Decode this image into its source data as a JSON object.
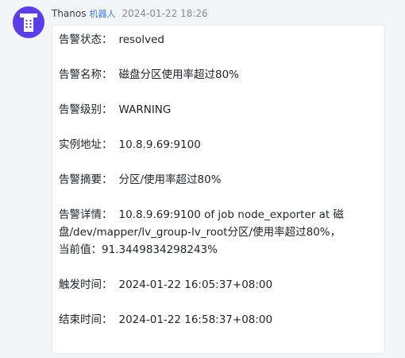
{
  "message": {
    "sender": "Thanos",
    "bot_tag": "机器人",
    "timestamp": "2024-01-22 18:26",
    "avatar_color": "#5b3ee8"
  },
  "alert": {
    "fields": [
      {
        "label": "告警状态：",
        "value": "resolved"
      },
      {
        "label": "告警名称：",
        "value": "磁盘分区使用率超过80%"
      },
      {
        "label": "告警级别：",
        "value": "WARNING"
      },
      {
        "label": "实例地址：",
        "value": "10.8.9.69:9100"
      },
      {
        "label": "告警摘要：",
        "value": "分区/使用率超过80%"
      },
      {
        "label": "告警详情：",
        "value": "10.8.9.69:9100 of job node_exporter at 磁盘/dev/mapper/lv_group-lv_root分区/使用率超过80%，当前值：91.3449834298243%"
      },
      {
        "label": "触发时间：",
        "value": "2024-01-22 16:05:37+08:00"
      },
      {
        "label": "结束时间：",
        "value": "2024-01-22 16:58:37+08:00"
      }
    ]
  }
}
